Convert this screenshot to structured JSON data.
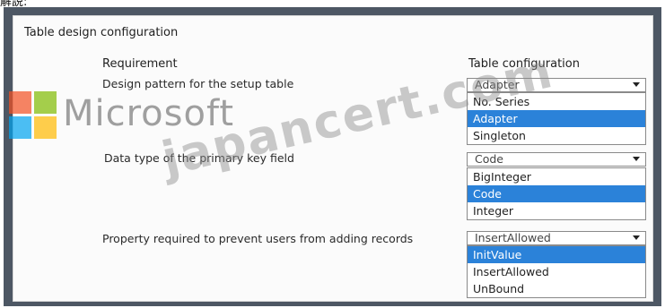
{
  "top_caption": "解説:",
  "panel": {
    "title": "Table design configuration",
    "requirement_header": "Requirement",
    "config_header": "Table configuration"
  },
  "rows": [
    {
      "requirement": "Design pattern for the setup table",
      "selected": "Adapter",
      "options": [
        "No. Series",
        "Adapter",
        "Singleton"
      ],
      "highlighted": "Adapter"
    },
    {
      "requirement": "Data type of the primary key field",
      "selected": "Code",
      "options": [
        "BigInteger",
        "Code",
        "Integer"
      ],
      "highlighted": "Code"
    },
    {
      "requirement": "Property required to prevent users from adding records",
      "selected": "InsertAllowed",
      "options": [
        "InitValue",
        "InsertAllowed",
        "UnBound"
      ],
      "highlighted": "InitValue"
    }
  ],
  "watermark": {
    "brand": "Microsoft",
    "site": "japancert.com"
  },
  "colors": {
    "frame": "#4d5764",
    "highlight": "#2b82d9"
  }
}
